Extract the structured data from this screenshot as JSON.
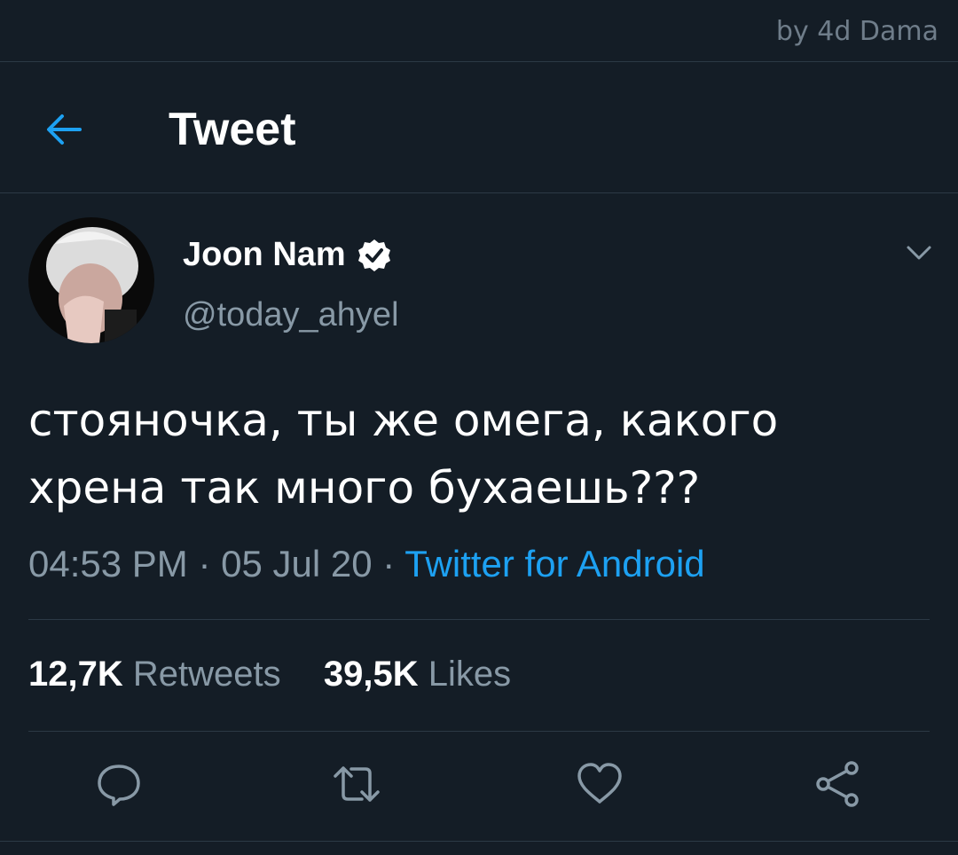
{
  "watermark": "by 4d Dama",
  "header": {
    "title": "Tweet"
  },
  "tweet": {
    "author": {
      "name": "Joon Nam",
      "handle": "@today_ahyel"
    },
    "text_lines": [
      "стояночка, ты же омега, какого",
      "хрена так много бухаешь???"
    ],
    "time": "04:53 PM",
    "separator": "·",
    "date": "05 Jul 20",
    "source": "Twitter for Android",
    "stats": {
      "retweets_count": "12,7K",
      "retweets_label": "Retweets",
      "likes_count": "39,5K",
      "likes_label": "Likes"
    }
  },
  "colors": {
    "background": "#141d26",
    "accent": "#1da1f2",
    "secondary_text": "#8899a6",
    "divider": "#2c3945"
  },
  "icons": {
    "back": "arrow-left-icon",
    "verified": "verified-badge-icon",
    "caret": "chevron-down-icon",
    "reply": "reply-icon",
    "retweet": "retweet-icon",
    "like": "heart-icon",
    "share": "share-icon"
  }
}
